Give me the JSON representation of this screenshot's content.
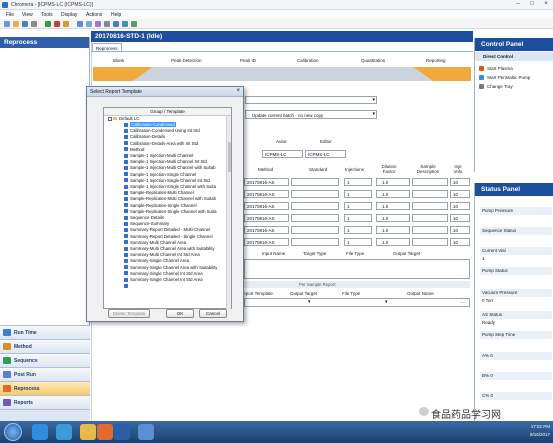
{
  "window": {
    "title": "Chromera - [ICPMS-LC (ICPMS-LC)]"
  },
  "menu": [
    "File",
    "View",
    "Tools",
    "Display",
    "Actions",
    "Help"
  ],
  "left_panel": {
    "header": "Reprocess",
    "nav": [
      "Run Time",
      "Method",
      "Sequence",
      "Post Run",
      "Reprocess",
      "Reports"
    ],
    "active": "Reprocess"
  },
  "main": {
    "title": "20170816-STD-1 (Idle)",
    "tab": "Reprocess",
    "workflow": [
      "Blank",
      "Peak Detection",
      "Peak ID",
      "Calibration",
      "Quantitation",
      "Reporting"
    ],
    "batch_dropdown": "Update current batch - no new copy",
    "table1": {
      "headers": [
        "Autor",
        "Editor"
      ],
      "values": [
        "ICPMS-LC",
        "ICPMS-LC"
      ]
    },
    "table2": {
      "headers": [
        "Method",
        "Standard",
        "Injections",
        "Dilution Factor",
        "Sample Description",
        "Inje Volu"
      ],
      "rows": [
        {
          "method": "20170816-AS",
          "injections": "1",
          "dilution": "1.0",
          "volume": "10"
        },
        {
          "method": "20170816-AS",
          "injections": "1",
          "dilution": "1.0",
          "volume": "10"
        },
        {
          "method": "20170816-AS",
          "injections": "1",
          "dilution": "1.0",
          "volume": "10"
        },
        {
          "method": "20170816-AS",
          "injections": "1",
          "dilution": "1.0",
          "volume": "10"
        },
        {
          "method": "20170816-AS",
          "injections": "1",
          "dilution": "1.0",
          "volume": "10"
        },
        {
          "method": "20170816-AS",
          "injections": "1",
          "dilution": "1.0",
          "volume": "10"
        }
      ]
    },
    "table3_headers": [
      "Input Name",
      "Target Type",
      "File Type",
      "Output Target"
    ],
    "per_sample_label": "Per Sample Report",
    "table4_headers": [
      "Report Template",
      "Output Target",
      "File Type",
      "Output Name"
    ]
  },
  "dialog": {
    "title": "Select Report Template",
    "column_header": "Group / Template",
    "root": "Default LC",
    "items": [
      "Calibration-Condensed",
      "Calibration-Condensed Using Int Std",
      "Calibration-Details",
      "Calibration-Details-Area with Int Std",
      "Method",
      "Sample-1 Injection-Multi Channel",
      "Sample-1 Injection-Multi Channel Int Std",
      "Sample-1 Injection-Multi Channel with Suitab",
      "Sample-1 Injection-Single Channel",
      "Sample-1 Injection-Single Channel Int Std",
      "Sample-1 Injection-Single Channel with Suita",
      "Sample-Replicates-Multi Channel",
      "Sample-Replicates-Multi Channel with Suitab",
      "Sample-Replicates-Single Channel",
      "Sample-Replicates-Single Channel with Suita",
      "Sequence-Details",
      "Sequence-Summary",
      "Summary-Report Detailed - Multi-Channel",
      "Summary-Report Detailed - Single Channel",
      "Summary-Multi Channel Area",
      "Summary-Multi Channel Area with Suitability",
      "Summary-Multi Channel Int Std Area",
      "Summary-Single Channel Area",
      "Summary-Single Channel Area with Suitability",
      "Summary-Single Channel Int Std Area",
      "Summary-Single Channel Int Std Area"
    ],
    "selected": "Calibration-Condensed",
    "buttons": {
      "delete": "Delete Template",
      "ok": "OK",
      "cancel": "Cancel"
    }
  },
  "control_panel": {
    "header": "Control Panel",
    "subheader": "Direct Control",
    "items": [
      "Start Plasma",
      "Start Peristaltic Pump",
      "Change Tray"
    ]
  },
  "status_panel": {
    "header": "Status Panel",
    "fields": [
      {
        "label": "Pump Pressure",
        "value": ""
      },
      {
        "label": "Sequence Status",
        "value": ""
      },
      {
        "label": "Current Vial",
        "value": "1"
      },
      {
        "label": "Pump Status",
        "value": ""
      },
      {
        "label": "Vacuum Pressure",
        "value": "0 Torr"
      },
      {
        "label": "AS Status",
        "value": "Ready"
      },
      {
        "label": "Pump Step Time",
        "value": ""
      },
      {
        "label": "A% 0",
        "value": ""
      },
      {
        "label": "B% 0",
        "value": ""
      },
      {
        "label": "C% 0",
        "value": ""
      }
    ]
  },
  "taskbar": {
    "time": "17:02 PM",
    "date": "8/16/2017"
  },
  "watermark": "食品药品学习网"
}
